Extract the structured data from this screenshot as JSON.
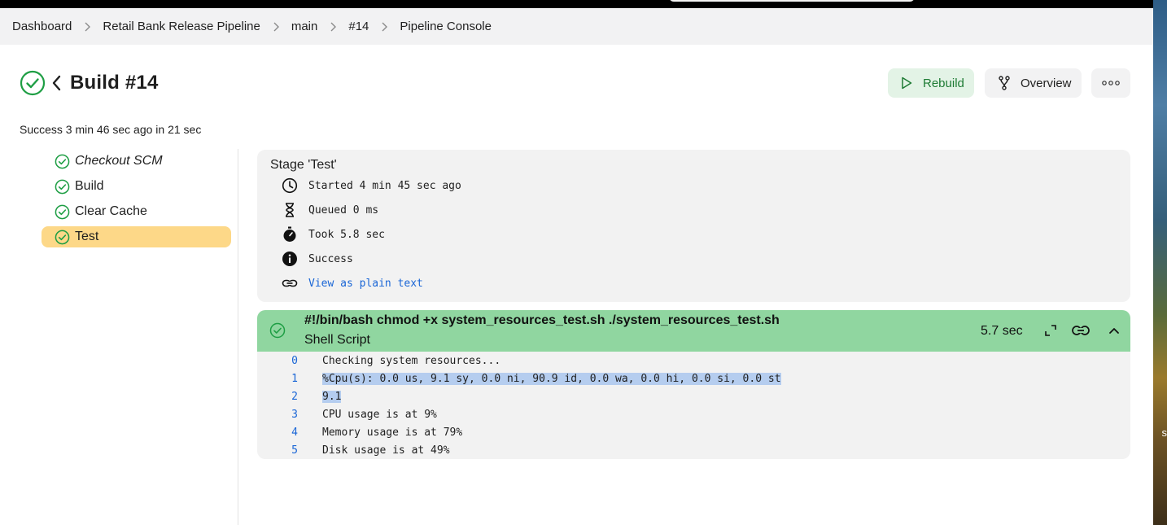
{
  "breadcrumb": [
    "Dashboard",
    "Retail Bank Release Pipeline",
    "main",
    "#14",
    "Pipeline Console"
  ],
  "header": {
    "title": "Build #14",
    "status_line": "Success 3 min 46 sec ago in 21 sec",
    "rebuild_label": "Rebuild",
    "overview_label": "Overview"
  },
  "stages": [
    {
      "label": "Checkout SCM",
      "status": "success",
      "italic": true
    },
    {
      "label": "Build",
      "status": "success"
    },
    {
      "label": "Clear Cache",
      "status": "success"
    },
    {
      "label": "Test",
      "status": "success",
      "selected": true
    }
  ],
  "stage_detail": {
    "title": "Stage 'Test'",
    "started": "Started 4 min 45 sec ago",
    "queued": "Queued 0 ms",
    "took": "Took 5.8 sec",
    "status": "Success",
    "plain_text_link": "View as plain text"
  },
  "step": {
    "command": "#!/bin/bash chmod +x system_resources_test.sh ./system_resources_test.sh",
    "kind": "Shell Script",
    "duration": "5.7 sec",
    "log": [
      {
        "n": "0",
        "text": "Checking system resources..."
      },
      {
        "n": "1",
        "text": "%Cpu(s): 0.0 us, 9.1 sy, 0.0 ni, 90.9 id, 0.0 wa, 0.0 hi, 0.0 si, 0.0 st",
        "highlight": true
      },
      {
        "n": "2",
        "text": "9.1",
        "highlight": true
      },
      {
        "n": "3",
        "text": "CPU usage is at 9%"
      },
      {
        "n": "4",
        "text": "Memory usage is at 79%"
      },
      {
        "n": "5",
        "text": "Disk usage is at 49%"
      }
    ]
  },
  "desktop_peek_text": "s",
  "colors": {
    "success": "#1e9e44",
    "selected_stage": "#fdd888",
    "step_header": "#90d6a0",
    "link": "#1a66d6",
    "log_highlight": "#b5cdef"
  }
}
